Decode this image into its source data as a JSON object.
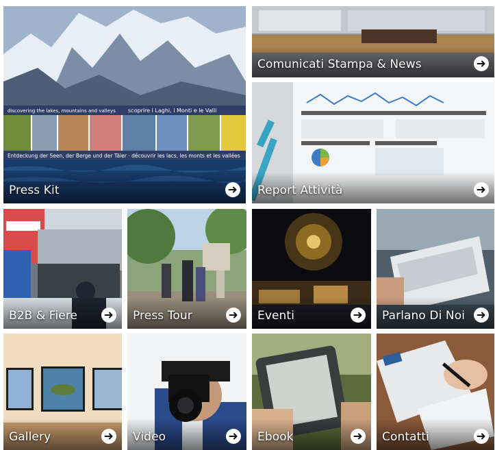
{
  "tiles": {
    "press_kit": {
      "label": "Press Kit",
      "banner_top_left": "discovering the lakes, mountains and valleys",
      "banner_top_right": "scoprire i Laghi, i Monti e le Valli",
      "banner_bottom": "Entdeckung der Seen, der Berge und der Täler · découvrir les lacs, les monts et les vallées"
    },
    "comunicati": {
      "label": "Comunicati Stampa & News"
    },
    "report": {
      "label": "Report Attività"
    },
    "b2b": {
      "label": "B2B & Fiere"
    },
    "press_tour": {
      "label": "Press Tour"
    },
    "eventi": {
      "label": "Eventi"
    },
    "parlano": {
      "label": "Parlano Di Noi"
    },
    "gallery": {
      "label": "Gallery"
    },
    "video": {
      "label": "Video"
    },
    "ebook": {
      "label": "Ebook"
    },
    "contatti": {
      "label": "Contatti"
    }
  },
  "arrow_icon": "arrow-right-circle-icon"
}
